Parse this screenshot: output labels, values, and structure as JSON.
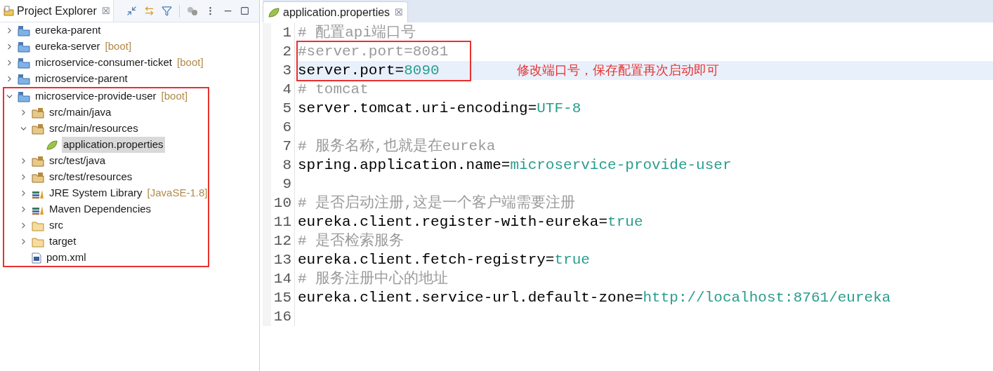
{
  "explorer": {
    "title": "Project Explorer",
    "close": "☒",
    "items": [
      {
        "label": "eureka-parent",
        "kind": "project",
        "expanded": false,
        "selected": false
      },
      {
        "label": "eureka-server",
        "decoration": "[boot]",
        "kind": "project",
        "expanded": false,
        "selected": false
      },
      {
        "label": "microservice-consumer-ticket",
        "decoration": "[boot]",
        "kind": "project",
        "expanded": false,
        "selected": false
      },
      {
        "label": "microservice-parent",
        "kind": "project",
        "expanded": false,
        "selected": false
      },
      {
        "label": "microservice-provide-user",
        "decoration": "[boot]",
        "kind": "project",
        "expanded": true,
        "selected": false,
        "boxed": true,
        "children": [
          {
            "label": "src/main/java",
            "kind": "package",
            "expanded": false,
            "selected": false
          },
          {
            "label": "src/main/resources",
            "kind": "package",
            "expanded": true,
            "selected": false,
            "children": [
              {
                "label": "application.properties",
                "kind": "properties",
                "selected": true
              }
            ]
          },
          {
            "label": "src/test/java",
            "kind": "package",
            "expanded": false,
            "selected": false
          },
          {
            "label": "src/test/resources",
            "kind": "package",
            "expanded": false,
            "selected": false
          },
          {
            "label": "JRE System Library",
            "decoration": "[JavaSE-1.8]",
            "kind": "library",
            "expanded": false,
            "selected": false
          },
          {
            "label": "Maven Dependencies",
            "kind": "library",
            "expanded": false,
            "selected": false
          },
          {
            "label": "src",
            "kind": "folder",
            "expanded": false,
            "selected": false
          },
          {
            "label": "target",
            "kind": "folder",
            "expanded": false,
            "selected": false
          },
          {
            "label": "pom.xml",
            "kind": "file",
            "selected": false
          }
        ]
      }
    ]
  },
  "editor": {
    "tab": {
      "label": "application.properties",
      "close": "☒"
    },
    "lines": [
      {
        "number": "1",
        "segments": [
          {
            "kind": "comment",
            "text": "# 配置api端口号"
          }
        ]
      },
      {
        "number": "2",
        "segments": [
          {
            "kind": "comment",
            "text": "#server.port=8081"
          }
        ],
        "boxed": true
      },
      {
        "number": "3",
        "segments": [
          {
            "kind": "key",
            "text": "server.port="
          },
          {
            "kind": "value",
            "text": "8090"
          }
        ],
        "current": true,
        "boxed": true,
        "note": "修改端口号，保存配置再次启动即可"
      },
      {
        "number": "4",
        "segments": [
          {
            "kind": "comment",
            "text": "# tomcat"
          }
        ]
      },
      {
        "number": "5",
        "segments": [
          {
            "kind": "key",
            "text": "server.tomcat.uri-encoding="
          },
          {
            "kind": "value",
            "text": "UTF-8"
          }
        ]
      },
      {
        "number": "6"
      },
      {
        "number": "7",
        "segments": [
          {
            "kind": "comment",
            "text": "# 服务名称,也就是在eureka"
          }
        ]
      },
      {
        "number": "8",
        "segments": [
          {
            "kind": "key",
            "text": "spring.application.name="
          },
          {
            "kind": "value",
            "text": "microservice-provide-user"
          }
        ]
      },
      {
        "number": "9"
      },
      {
        "number": "10",
        "segments": [
          {
            "kind": "comment",
            "text": "# 是否启动注册,这是一个客户端需要注册"
          }
        ]
      },
      {
        "number": "11",
        "segments": [
          {
            "kind": "key",
            "text": "eureka.client.register-with-eureka="
          },
          {
            "kind": "value",
            "text": "true"
          }
        ]
      },
      {
        "number": "12",
        "segments": [
          {
            "kind": "comment",
            "text": "# 是否检索服务"
          }
        ]
      },
      {
        "number": "13",
        "segments": [
          {
            "kind": "key",
            "text": "eureka.client.fetch-registry="
          },
          {
            "kind": "value",
            "text": "true"
          }
        ]
      },
      {
        "number": "14",
        "segments": [
          {
            "kind": "comment",
            "text": "# 服务注册中心的地址"
          }
        ]
      },
      {
        "number": "15",
        "segments": [
          {
            "kind": "key",
            "text": "eureka.client.service-url.default-zone="
          },
          {
            "kind": "value",
            "text": "http://localhost:8761/eureka"
          }
        ]
      },
      {
        "number": "16"
      }
    ]
  }
}
